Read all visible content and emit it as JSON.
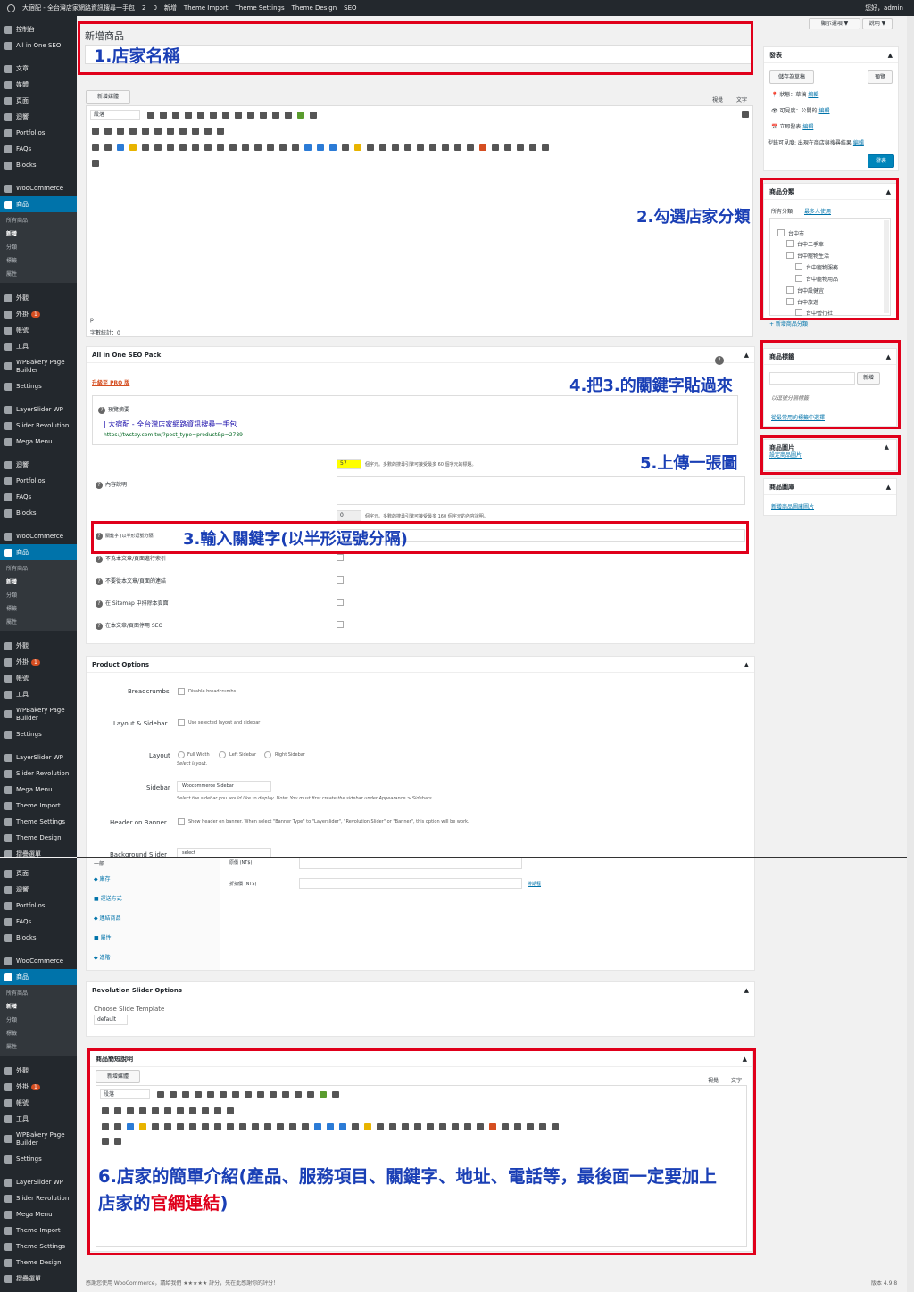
{
  "adminbar": {
    "site": "大宿配 - 全台灣店家網路資訊搜尋一手包",
    "comments": "2",
    "pending": "0",
    "new": "新增",
    "theme_import": "Theme Import",
    "theme_settings": "Theme Settings",
    "theme_design": "Theme Design",
    "seo": "SEO",
    "greeting": "您好，admin"
  },
  "screen_options": "顯示選項 ▼",
  "help": "說明 ▼",
  "page_title": "新增商品",
  "sidebar_top": {
    "dashboard": "控制台",
    "aioseo": "All in One SEO",
    "posts": "文章",
    "media": "媒體",
    "pages": "頁面",
    "comments": "迴響",
    "portfolios": "Portfolios",
    "faqs": "FAQs",
    "blocks": "Blocks",
    "woocommerce": "WooCommerce",
    "products": "商品",
    "sub_all": "所有商品",
    "sub_new": "新增",
    "sub_cat": "分類",
    "sub_tag": "標籤",
    "sub_attr": "屬性",
    "appearance": "外觀",
    "plugins": "外掛",
    "plugins_badge": "1",
    "users": "帳號",
    "tools": "工具",
    "wpbakery": "WPBakery Page Builder",
    "settings": "Settings",
    "layerslider": "LayerSlider WP",
    "revslider": "Slider Revolution",
    "megamenu": "Mega Menu",
    "theme_import": "Theme Import",
    "theme_settings": "Theme Settings",
    "theme_design": "Theme Design",
    "collapse": "摺疊選單"
  },
  "editor": {
    "add_media": "新增媒體",
    "tab_visual": "視覺",
    "tab_text": "文字",
    "format": "段落",
    "path": "p",
    "wordcount": "字數統計：0"
  },
  "publish": {
    "title": "發表",
    "save_draft": "儲存為草稿",
    "preview": "預覽",
    "status": "狀態：",
    "status_val": "草稿",
    "edit": "編輯",
    "visibility": "可見度：",
    "visibility_val": "公開的",
    "schedule": "立即發表",
    "catalog": "型錄可見度: 出現在商店與搜尋結果",
    "publish_btn": "發表"
  },
  "categories": {
    "title": "商品分類",
    "tab_all": "所有分類",
    "tab_popular": "最多人使用",
    "items": [
      "台中市",
      "台中二手車",
      "台中寵物生活",
      "台中寵物服務",
      "台中寵物用品",
      "台中設健宜",
      "台中旅遊",
      "台中營行社"
    ],
    "add_new": "+ 新增商品分類"
  },
  "tags": {
    "title": "商品標籤",
    "add_btn": "新增",
    "hint": "以逗號分隔標籤",
    "popular": "從最常用的標籤中選擇"
  },
  "product_image": {
    "title": "商品圖片",
    "link": "設定商品圖片"
  },
  "gallery": {
    "title": "商品圖庫",
    "link": "新增商品圖庫圖片"
  },
  "seo": {
    "title": "All in One SEO Pack",
    "upgrade": "升級至 PRO 版",
    "preview_label": "預覽摘要",
    "preview_title": "| 大宿配 - 全台灣店家網路資訊搜尋一手包",
    "preview_url": "https://twstay.com.tw/?post_type=product&p=2789",
    "title_count": "57",
    "title_hint": "個字元。多數的搜尋引擎可接受最多 60 個字元的標題。",
    "desc_label": "內容說明",
    "desc_count": "0",
    "desc_hint": "個字元。多數的搜尋引擎可接受最多 160 個字元的內容說明。",
    "keywords_label": "關鍵字 (以半形逗號分隔)",
    "noindex": "不為本文章/頁面進行索引",
    "nofollow": "不要從本文章/頁面的連結",
    "sitemap": "在 Sitemap 中排除本頁面",
    "disable": "在本文章/頁面停用 SEO"
  },
  "product_options": {
    "title": "Product Options",
    "breadcrumbs": "Breadcrumbs",
    "breadcrumbs_opt": "Disable breadcrumbs",
    "layout_sidebar": "Layout & Sidebar",
    "layout_sidebar_opt": "Use selected layout and sidebar",
    "layout": "Layout",
    "full_width": "Full Width",
    "left_sidebar": "Left Sidebar",
    "right_sidebar": "Right Sidebar",
    "select_layout": "Select layout.",
    "sidebar": "Sidebar",
    "sidebar_val": "Woocommerce Sidebar",
    "sidebar_hint": "Select the sidebar you would like to display. Note: You must first create the sidebar under Appearance > Sidebars.",
    "header_banner": "Header on Banner",
    "header_banner_hint": "Show header on banner. When select \"Banner Type\" to \"Layerslider\", \"Revolution Slider\" or \"Banner\", this option will be work.",
    "bg_slider": "Background Slider",
    "bg_slider_val": "select"
  },
  "product_data": {
    "tabs": [
      "一般",
      "庫存",
      "運送方式",
      "連結商品",
      "屬性",
      "進階"
    ],
    "price_label": "原價 (NT$)",
    "sale_label": "折扣價 (NT$)",
    "schedule": "排期程"
  },
  "revslider_box": {
    "title": "Revolution Slider Options",
    "choose": "Choose Slide Template",
    "val": "default"
  },
  "short_desc": {
    "title": "商品簡短說明"
  },
  "footer": {
    "thanks": "感謝您使用 WooCommerce，請給我們 ★★★★★ 評分，先在此感謝你的評分！",
    "version": "版本 4.9.8"
  },
  "annotations": {
    "a1": "1.店家名稱",
    "a2": "2.勾選店家分類",
    "a3": "3.輸入關鍵字(以半形逗號分隔)",
    "a4": "4.把3.的關鍵字貼過來",
    "a5": "5.上傳一張圖",
    "a6_line1": "6.店家的簡單介紹(產品、服務項目、關鍵字、地址、電話等，最後面一定要加上",
    "a6_line2_pre": "店家的",
    "a6_line2_red": "官網連結",
    "a6_line2_post": ")"
  },
  "colors": {
    "adminbar": "#23282d",
    "accent": "#0073aa",
    "annotation_red": "#e0001b",
    "annotation_blue": "#1a3fb5"
  }
}
